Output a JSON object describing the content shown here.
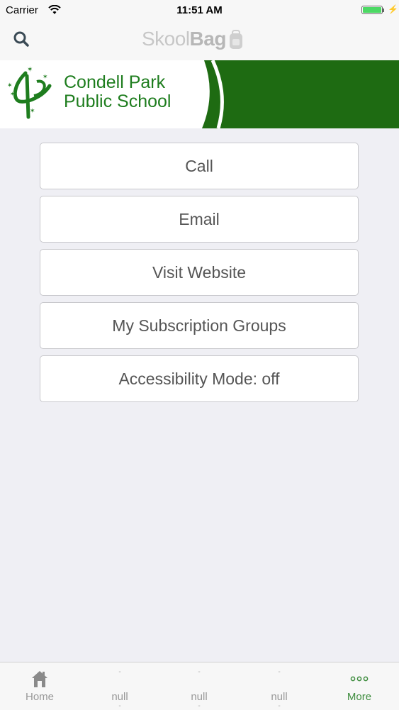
{
  "status_bar": {
    "carrier": "Carrier",
    "time": "11:51 AM",
    "battery_level": 1.0,
    "battery_color": "#4cd964"
  },
  "nav_bar": {
    "search_icon": "search-icon",
    "logo_text_light": "Skool",
    "logo_text_bold": "Bag"
  },
  "banner": {
    "school_name_line1": "Condell Park",
    "school_name_line2": "Public School",
    "brand_color": "#1e6b12"
  },
  "menu": {
    "items": [
      {
        "label": "Call"
      },
      {
        "label": "Email"
      },
      {
        "label": "Visit Website"
      },
      {
        "label": "My Subscription Groups"
      },
      {
        "label": "Accessibility Mode: off"
      }
    ]
  },
  "tab_bar": {
    "tabs": [
      {
        "label": "Home",
        "icon": "home-icon"
      },
      {
        "label": "null",
        "icon": "placeholder"
      },
      {
        "label": "null",
        "icon": "placeholder"
      },
      {
        "label": "null",
        "icon": "placeholder"
      },
      {
        "label": "More",
        "icon": "more-icon",
        "active": true
      }
    ],
    "active_color": "#3f8d3f"
  }
}
